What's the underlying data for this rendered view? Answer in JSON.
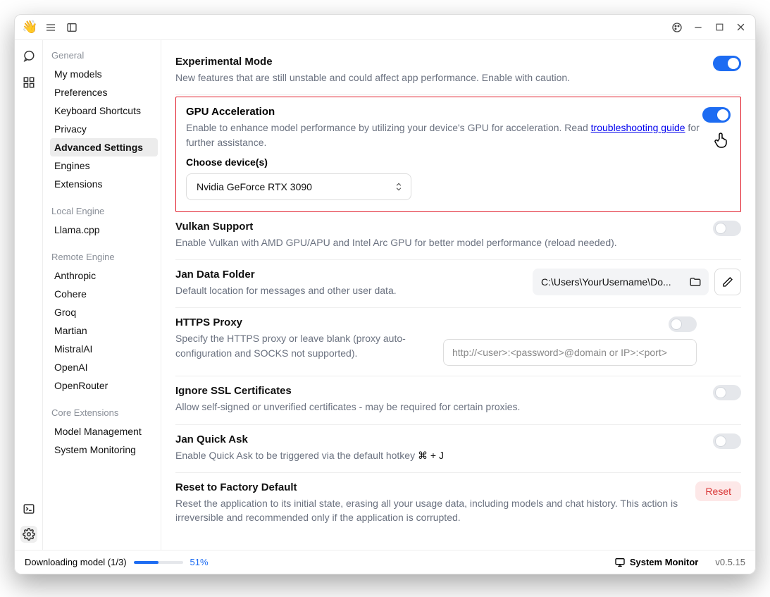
{
  "titlebar": {
    "menu_icon": "menu",
    "panel_icon": "panel"
  },
  "rail": {
    "chat": "chat",
    "grid": "grid",
    "terminal": "terminal",
    "settings": "settings"
  },
  "sidebar": {
    "groups": [
      {
        "header": "General",
        "items": [
          "My models",
          "Preferences",
          "Keyboard Shortcuts",
          "Privacy",
          "Advanced Settings",
          "Engines",
          "Extensions"
        ],
        "activeIndex": 4
      },
      {
        "header": "Local Engine",
        "items": [
          "Llama.cpp"
        ]
      },
      {
        "header": "Remote Engine",
        "items": [
          "Anthropic",
          "Cohere",
          "Groq",
          "Martian",
          "MistralAI",
          "OpenAI",
          "OpenRouter"
        ]
      },
      {
        "header": "Core Extensions",
        "items": [
          "Model Management",
          "System Monitoring"
        ]
      }
    ]
  },
  "settings": {
    "experimental": {
      "title": "Experimental Mode",
      "desc": "New features that are still unstable and could affect app performance. Enable with caution.",
      "on": true
    },
    "gpu": {
      "title": "GPU Acceleration",
      "desc_prefix": "Enable to enhance model performance by utilizing your device's GPU for acceleration. Read ",
      "link": "troubleshooting guide",
      "desc_suffix": " for further assistance.",
      "choose_label": "Choose device(s)",
      "selected": "Nvidia GeForce RTX 3090",
      "on": true
    },
    "vulkan": {
      "title": "Vulkan Support",
      "desc": "Enable Vulkan with AMD GPU/APU and Intel Arc GPU for better model performance (reload needed).",
      "on": false
    },
    "datafolder": {
      "title": "Jan Data Folder",
      "desc": "Default location for messages and other user data.",
      "path": "C:\\Users\\YourUsername\\Do..."
    },
    "proxy": {
      "title": "HTTPS Proxy",
      "desc": "Specify the HTTPS proxy or leave blank (proxy auto-configuration and SOCKS not supported).",
      "placeholder": "http://<user>:<password>@domain or IP>:<port>",
      "on": false
    },
    "ssl": {
      "title": "Ignore SSL Certificates",
      "desc": "Allow self-signed or unverified certificates - may be required for certain proxies.",
      "on": false
    },
    "quickask": {
      "title": "Jan Quick Ask",
      "desc_prefix": "Enable Quick Ask to be triggered via the default hotkey ",
      "hotkey": "⌘ + J",
      "on": false
    },
    "reset": {
      "title": "Reset to Factory Default",
      "desc": "Reset the application to its initial state, erasing all your usage data, including models and chat history. This action is irreversible and recommended only if the application is corrupted.",
      "button": "Reset"
    }
  },
  "statusbar": {
    "downloading": "Downloading model (1/3)",
    "percent": "51%",
    "progress_percent": 51,
    "system_monitor": "System Monitor",
    "version": "v0.5.15"
  }
}
